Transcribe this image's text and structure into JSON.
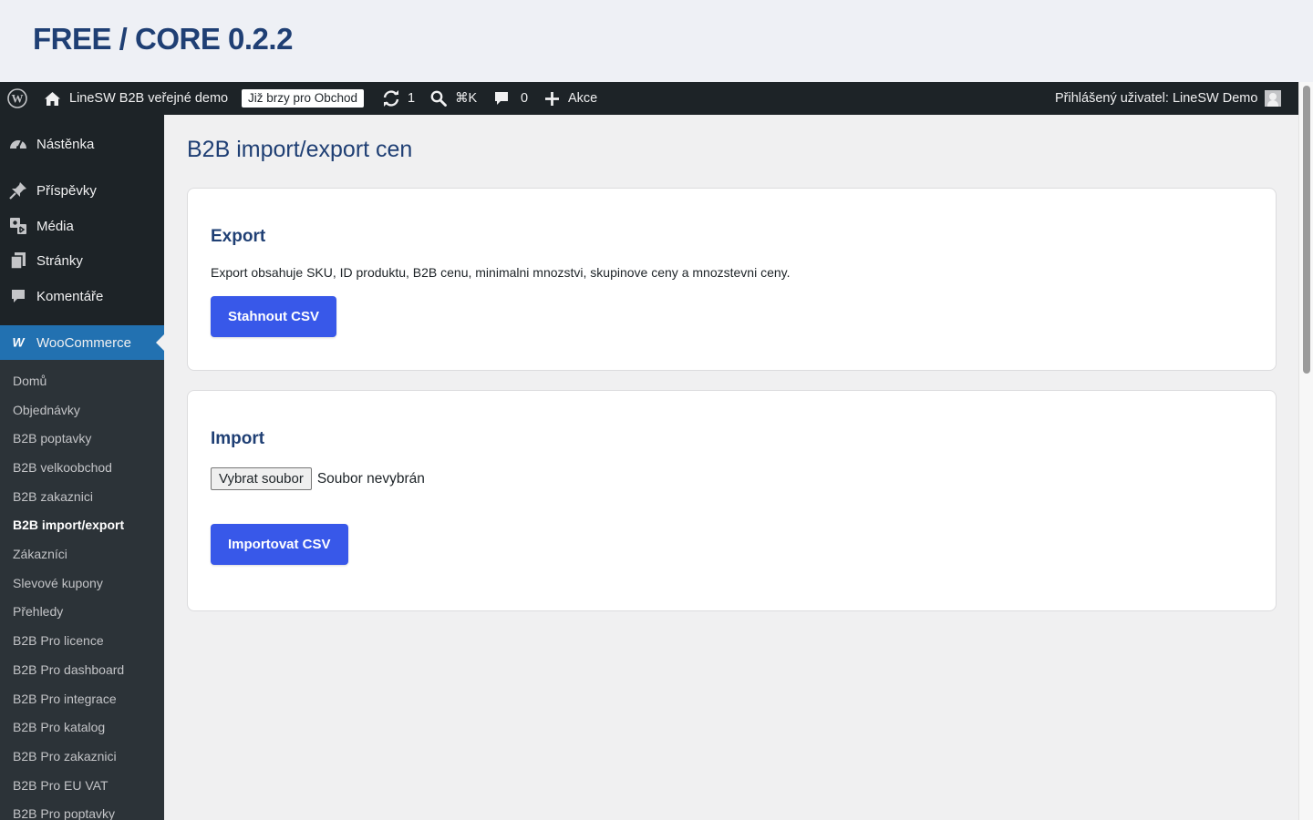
{
  "banner": {
    "title": "FREE / CORE 0.2.2"
  },
  "adminbar": {
    "site_name": "LineSW B2B veřejné demo",
    "coming_soon": "Již brzy pro Obchod",
    "updates_count": "1",
    "search_shortcut": "⌘K",
    "comments_count": "0",
    "new_label": "Akce",
    "user_greeting": "Přihlášený uživatel: LineSW Demo"
  },
  "sidebar": {
    "menu": [
      {
        "label": "Nástěnka",
        "icon": "dashboard-icon"
      },
      {
        "label": "Příspěvky",
        "icon": "pin-icon"
      },
      {
        "label": "Média",
        "icon": "media-icon"
      },
      {
        "label": "Stránky",
        "icon": "pages-icon"
      },
      {
        "label": "Komentáře",
        "icon": "comment-icon"
      },
      {
        "label": "WooCommerce",
        "icon": "woo-icon"
      }
    ],
    "submenu": [
      "Domů",
      "Objednávky",
      "B2B poptavky",
      "B2B velkoobchod",
      "B2B zakaznici",
      "B2B import/export",
      "Zákazníci",
      "Slevové kupony",
      "Přehledy",
      "B2B Pro licence",
      "B2B Pro dashboard",
      "B2B Pro integrace",
      "B2B Pro katalog",
      "B2B Pro zakaznici",
      "B2B Pro EU VAT",
      "B2B Pro poptavky"
    ],
    "current_submenu": "B2B import/export"
  },
  "page": {
    "title": "B2B import/export cen",
    "export": {
      "heading": "Export",
      "description": "Export obsahuje SKU, ID produktu, B2B cenu, minimalni mnozstvi, skupinove ceny a mnozstevni ceny.",
      "button": "Stahnout CSV"
    },
    "import": {
      "heading": "Import",
      "file_button": "Vybrat soubor",
      "file_status": "Soubor nevybrán",
      "button": "Importovat CSV"
    }
  },
  "colors": {
    "accent": "#3858e9",
    "wp_blue": "#2271b1",
    "heading": "#1f3f74",
    "adminbar": "#1d2327"
  }
}
